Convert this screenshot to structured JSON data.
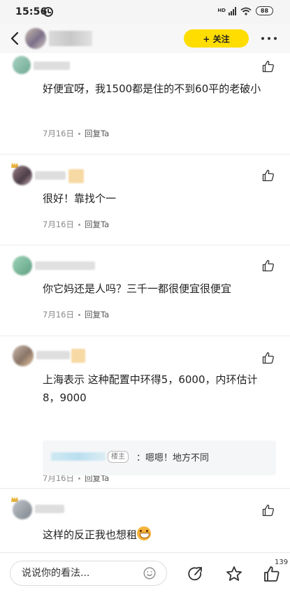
{
  "status_bar": {
    "time": "15:56",
    "network_label": "HD",
    "battery": "88"
  },
  "header": {
    "follow_label": "+ 关注"
  },
  "comments": [
    {
      "text": "好便宜呀，我1500都是住的不到60平的老破小",
      "date": "7月16日",
      "reply_label": "回复Ta"
    },
    {
      "text": "很好！靠找个一",
      "date": "7月16日",
      "reply_label": "回复Ta"
    },
    {
      "text": "你它妈还是人吗？三千一都很便宜很便宜",
      "date": "7月16日",
      "reply_label": "回复Ta"
    },
    {
      "text": "上海表示 这种配置中环得5，6000，内环估计8，9000",
      "date": "7月16日",
      "reply_label": "回复Ta",
      "sub_reply": {
        "badge": "楼主",
        "text": "：嗯嗯！地方不同"
      }
    },
    {
      "text": "这样的反正我也想租",
      "emoji": "grin-emoji"
    }
  ],
  "bottom_bar": {
    "input_placeholder": "说说你的看法...",
    "like_count": "139"
  },
  "colors": {
    "accent": "#ffdd00",
    "meta_text": "#888888",
    "divider": "#ebebeb"
  }
}
